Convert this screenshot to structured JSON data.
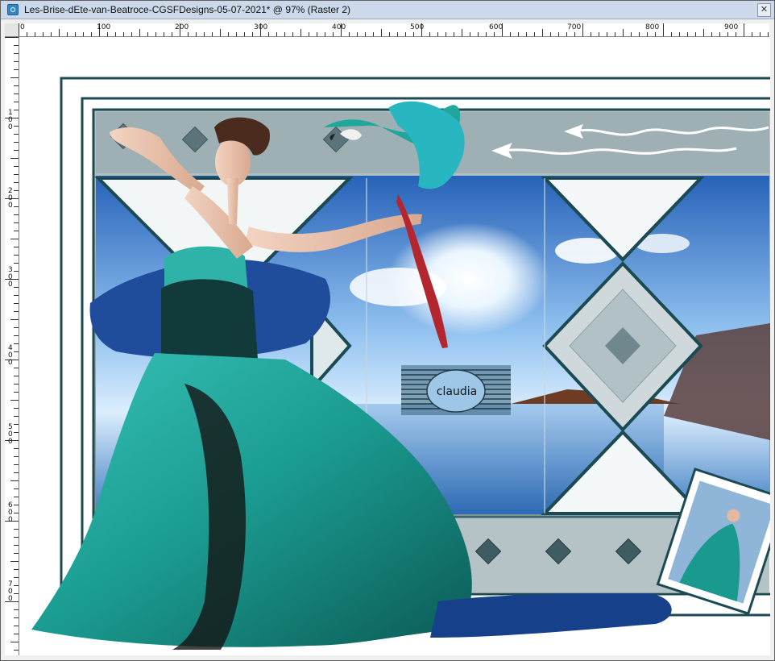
{
  "window": {
    "title": "Les-Brise-dEte-van-Beatroce-CGSFDesigns-05-07-2021* @  97% (Raster 2)",
    "close_glyph": "✕"
  },
  "rulers": {
    "horizontal_marks": [
      "0",
      "100",
      "200",
      "300",
      "400",
      "500",
      "600",
      "700",
      "800",
      "900"
    ],
    "vertical_marks": [
      "1\n0\n0",
      "2\n0\n0",
      "3\n0\n0",
      "4\n0\n0",
      "5\n0\n0",
      "6\n0\n0",
      "7\n0\n0"
    ]
  },
  "artwork": {
    "watermark": "claudia",
    "colors": {
      "frame": "#1c4a52",
      "teal": "#1a9a8f",
      "sky": "#2d79c9",
      "panel": "#a6b7bc"
    }
  },
  "icons": {
    "app": "psp-app-icon",
    "close": "close-icon",
    "parrot": "parrot-image",
    "woman": "woman-in-gown-image",
    "thumbnail": "thumbnail-preview-image"
  }
}
